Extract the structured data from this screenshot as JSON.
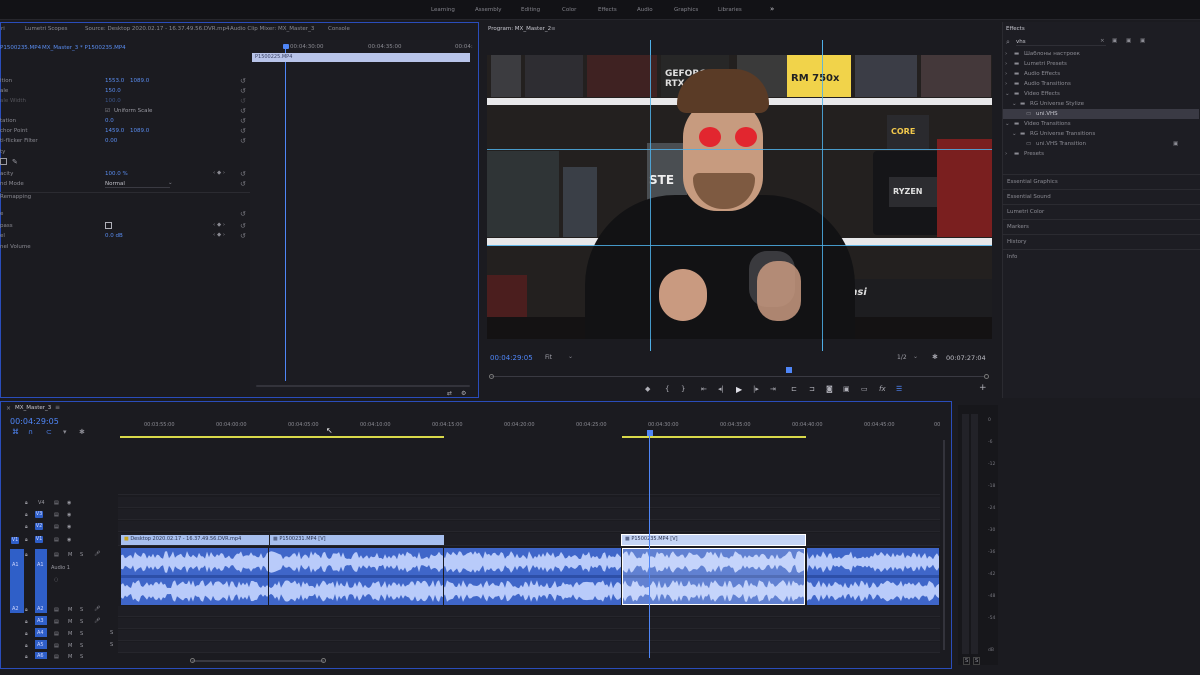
{
  "workspaces": [
    "Learning",
    "Assembly",
    "Editing",
    "Color",
    "Effects",
    "Audio",
    "Graphics",
    "Libraries"
  ],
  "source_panel": {
    "tabs": [
      "Lumetri Scopes",
      "Source: Desktop 2020.02.17 - 16.37.49.56.DVR.mp4",
      "Audio Clip Mixer: MX_Master_3",
      "Console"
    ],
    "tab_first": "ri",
    "clip_tab": "P1500235.MP4",
    "seq_tab": "MX_Master_3 * P1500235.MP4",
    "properties": [
      {
        "label": "ition",
        "v1": "1553.0",
        "v2": "1089.0"
      },
      {
        "label": "ale",
        "v1": "150.0",
        "v2": ""
      },
      {
        "label": "ale Width",
        "v1": "100.0",
        "v2": ""
      },
      {
        "label": "",
        "v1": "Uniform Scale",
        "v2": ""
      },
      {
        "label": "tation",
        "v1": "0.0",
        "v2": ""
      },
      {
        "label": "chor Point",
        "v1": "1459.0",
        "v2": "1089.0"
      },
      {
        "label": "ti-flicker Filter",
        "v1": "0.00",
        "v2": ""
      },
      {
        "label": "ty",
        "v1": "",
        "v2": ""
      },
      {
        "label": "",
        "v1": "",
        "v2": ""
      },
      {
        "label": "acity",
        "v1": "100.0 %",
        "v2": ""
      },
      {
        "label": "nd Mode",
        "v1": "Normal",
        "v2": ""
      },
      {
        "label": "Remapping",
        "v1": "",
        "v2": ""
      },
      {
        "label": "",
        "v1": "",
        "v2": ""
      },
      {
        "label": "e",
        "v1": "",
        "v2": ""
      },
      {
        "label": "pass",
        "v1": "",
        "v2": ""
      },
      {
        "label": "el",
        "v1": "0.0 dB",
        "v2": ""
      },
      {
        "label": "nel Volume",
        "v1": "",
        "v2": ""
      }
    ],
    "src_ruler": [
      "00:04:30:00",
      "00:04:35:00",
      "00:04:"
    ],
    "src_clip_label": "P1500225.MP4"
  },
  "program": {
    "title": "Program: MX_Master_2",
    "timecode": "00:04:29:05",
    "fit": "Fit",
    "resolution": "1/2",
    "duration": "00:07:27:04",
    "video_labels": [
      "GEFORCE RTX",
      "RM 750x",
      "CORE",
      "RYZEN",
      "STE",
      "msi"
    ]
  },
  "effects": {
    "title": "Effects",
    "search": "vhs",
    "items": [
      "Шаблоны настроек",
      "Lumetri Presets",
      "Audio Effects",
      "Audio Transitions",
      "Video Effects",
      "RG Universe Stylize",
      "uni.VHS",
      "Video Transitions",
      "RG Universe Transitions",
      "uni.VHS Transition",
      "Presets"
    ],
    "sections": [
      "Essential Graphics",
      "Essential Sound",
      "Lumetri Color",
      "Markers",
      "History",
      "Info"
    ]
  },
  "timeline": {
    "tab": "MX_Master_3",
    "timecode": "00:04:29:05",
    "ruler": [
      "00:03:55:00",
      "00:04:00:00",
      "00:04:05:00",
      "00:04:10:00",
      "00:04:15:00",
      "00:04:20:00",
      "00:04:25:00",
      "00:04:30:00",
      "00:04:35:00",
      "00:04:40:00",
      "00:04:45:00",
      "00"
    ],
    "video_clips": [
      "Desktop 2020.02.17 - 16.37.49.56.DVR.mp4",
      "P1500231.MP4 [V]",
      "P1500235.MP4 [V]"
    ],
    "tracks_video": [
      "V4",
      "V3",
      "V2",
      "V1"
    ],
    "tracks_audio": [
      "A1",
      "A2",
      "A3",
      "A4",
      "A5",
      "A6"
    ],
    "audio_label": "Audio 1",
    "meter_ticks": [
      "0",
      "-6",
      "-12",
      "-18",
      "-24",
      "-30",
      "-36",
      "-42",
      "-48",
      "-54",
      "dB"
    ],
    "meter_sm": [
      "S",
      "S"
    ]
  }
}
